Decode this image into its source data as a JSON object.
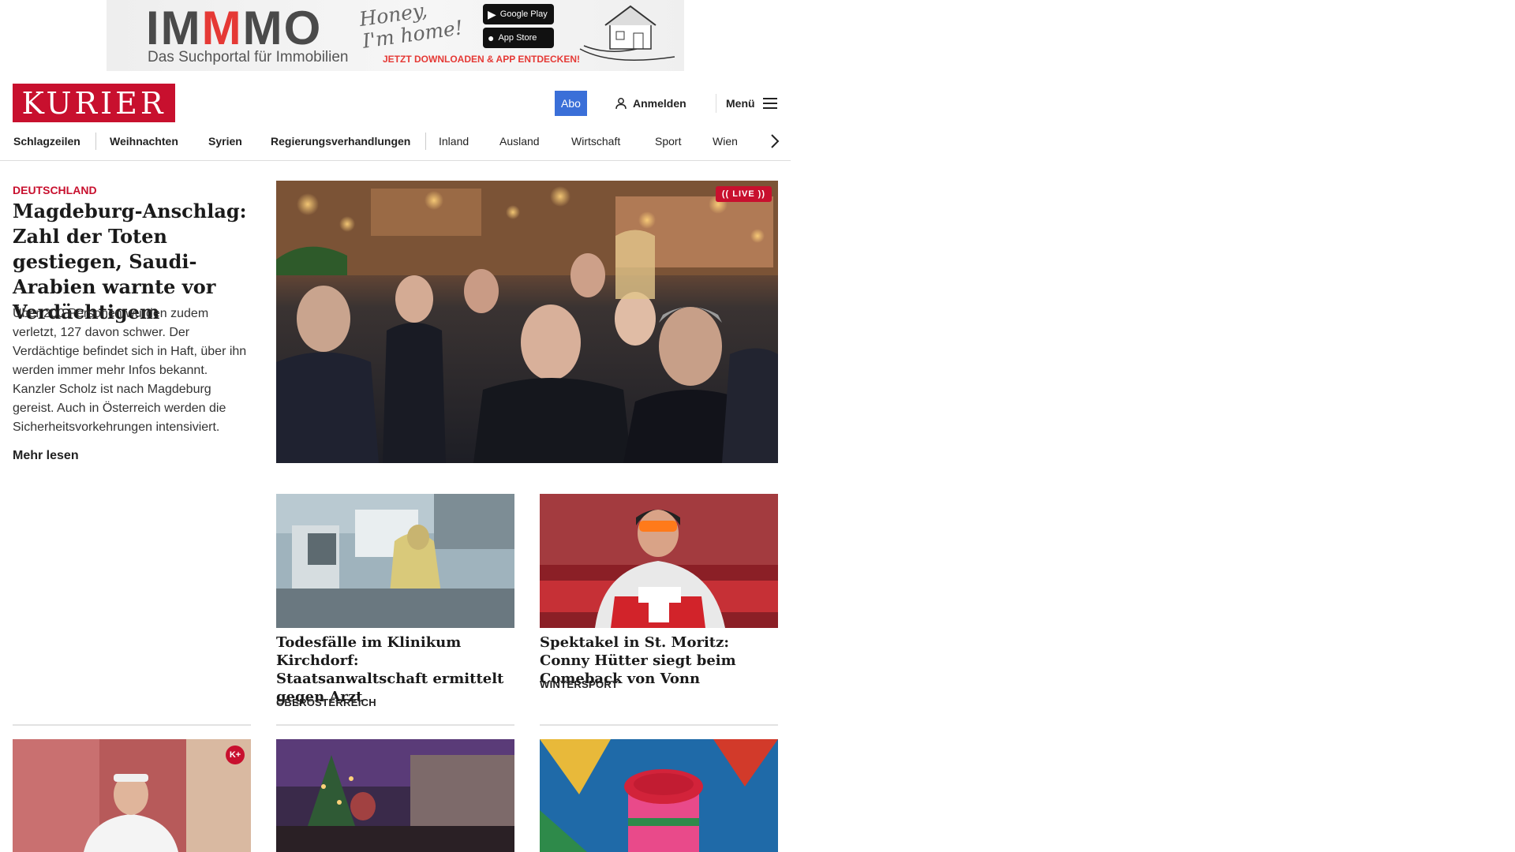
{
  "ad": {
    "logo_pre": "IM",
    "logo_m": "M",
    "logo_post": "MO",
    "tagline": "Das Suchportal für Immobilien",
    "slogan": "Honey, I'm home!",
    "google_play": "Google Play",
    "app_store": "App Store",
    "cta": "JETZT DOWNLOADEN & APP ENTDECKEN!"
  },
  "header": {
    "logo": "KURIER",
    "abo": "Abo",
    "login": "Anmelden",
    "menu": "Menü"
  },
  "nav": {
    "items": [
      {
        "label": "Schlagzeilen"
      },
      {
        "label": "Weihnachten"
      },
      {
        "label": "Syrien"
      },
      {
        "label": "Regierungsverhandlungen"
      },
      {
        "label": "Inland"
      },
      {
        "label": "Ausland"
      },
      {
        "label": "Wirtschaft"
      },
      {
        "label": "Sport"
      },
      {
        "label": "Wien"
      }
    ]
  },
  "lead": {
    "kicker": "DEUTSCHLAND",
    "title": "Magdeburg-Anschlag: Zahl der Toten gestiegen, Saudi-Arabien warnte vor Verdächtigem",
    "teaser": "Über 200 Personen wurden zudem verletzt, 127 davon schwer. Der Verdächtige befindet sich in Haft, über ihn werden immer mehr Infos bekannt. Kanzler Scholz ist nach Magdeburg gereist. Auch in Österreich werden die Sicherheitsvorkehrungen intensiviert.",
    "more": "Mehr lesen",
    "live": "LIVE"
  },
  "cards": [
    {
      "title": "Todesfälle im Klinikum Kirchdorf: Staatsanwaltschaft ermittelt gegen Arzt",
      "kicker": "OBERÖSTERREICH"
    },
    {
      "title": "Spektakel in St. Moritz: Conny Hütter siegt beim Comeback von Vonn",
      "kicker": "WINTERSPORT"
    }
  ],
  "bottom": {
    "kplus": "K+"
  },
  "colors": {
    "brand_red": "#c8102e",
    "abo_blue": "#3a6fd8"
  }
}
